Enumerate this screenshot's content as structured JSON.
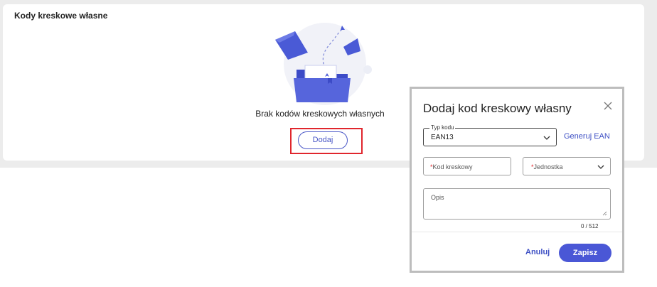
{
  "card": {
    "title": "Kody kreskowe własne",
    "empty_text": "Brak kodów kreskowych własnych",
    "add_button": "Dodaj"
  },
  "dialog": {
    "title": "Dodaj kod kreskowy własny",
    "code_type": {
      "legend": "Typ kodu",
      "value": "EAN13"
    },
    "generate_link": "Generuj EAN",
    "barcode_field": {
      "required_mark": "*",
      "placeholder": "Kod kreskowy"
    },
    "unit_field": {
      "required_mark": "*",
      "placeholder": "Jednostka"
    },
    "description_field": {
      "placeholder": "Opis",
      "counter": "0  / 512"
    },
    "cancel_label": "Anuluj",
    "save_label": "Zapisz"
  },
  "colors": {
    "accent": "#4a57d6",
    "link": "#3d4fc4",
    "highlight": "#e0262d",
    "page_background": "#ececec"
  },
  "icons": [
    "empty-folder-illustration",
    "close-icon",
    "chevron-down-icon",
    "resize-handle-icon"
  ]
}
